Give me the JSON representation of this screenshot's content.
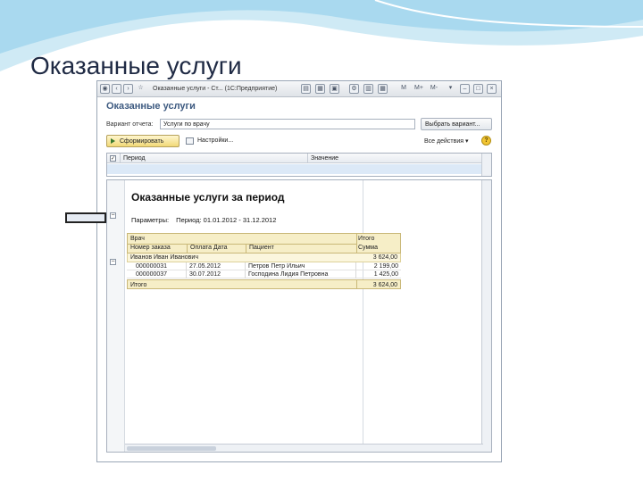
{
  "slide": {
    "title": "Оказанные услуги"
  },
  "window": {
    "caption": "Оказанные услуги - Ст... (1С:Предприятие)",
    "toolbar_icons": [
      "app-menu-icon",
      "back-icon",
      "forward-icon",
      "favorite-star-icon",
      "save-icon",
      "print-icon",
      "preview-icon",
      "print-setup-icon",
      "calendar-icon",
      "calculator-icon",
      "memory-m-icon",
      "memory-mplus-icon",
      "memory-mminus-icon",
      "more-icon",
      "minimize-icon",
      "maximize-icon",
      "close-icon"
    ],
    "memory_labels": [
      "M",
      "M+",
      "M-"
    ]
  },
  "form": {
    "title": "Оказанные услуги",
    "variant_label": "Вариант отчета:",
    "variant_value": "Услуги по врачу",
    "select_variant_label": "Выбрать вариант...",
    "generate_label": "Сформировать",
    "settings_label": "Настройки...",
    "actions_label": "Все действия ▾",
    "help_label": "?"
  },
  "settings_grid": {
    "columns": [
      "Период",
      "Значение"
    ]
  },
  "report": {
    "title": "Оказанные услуги за период",
    "params_label": "Параметры:",
    "params_value": "Период: 01.01.2012 - 31.12.2012",
    "header": {
      "col1_line1": "Врач",
      "col1_line2": "Номер заказа",
      "col2": "Оплата Дата",
      "col3": "Пациент",
      "col4_line1": "Итого",
      "col4_line2": "Сумма"
    },
    "group": {
      "doctor": "Иванов Иван Иванович",
      "amount": "3 624,00"
    },
    "rows": [
      {
        "order": "000000031",
        "date": "27.05.2012",
        "patient": "Петров Петр Ильич",
        "amount": "2 199,00"
      },
      {
        "order": "000000037",
        "date": "30.07.2012",
        "patient": "Господина Лидия Петровна",
        "amount": "1 425,00"
      }
    ],
    "total_label": "Итого",
    "total_amount": "3 624,00"
  },
  "colors": {
    "title_blue": "#3d5a80",
    "header_yellow": "#f6eec7",
    "slide_wave": "#bde3f2"
  }
}
